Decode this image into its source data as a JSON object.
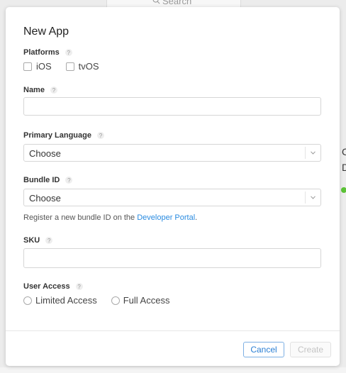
{
  "background": {
    "search_placeholder": "Search",
    "side_text_1": "C",
    "side_text_2": "D"
  },
  "modal": {
    "title": "New App",
    "platforms": {
      "label": "Platforms",
      "options": [
        "iOS",
        "tvOS"
      ]
    },
    "name": {
      "label": "Name",
      "value": ""
    },
    "primary_language": {
      "label": "Primary Language",
      "selected": "Choose"
    },
    "bundle_id": {
      "label": "Bundle ID",
      "selected": "Choose",
      "hint_prefix": "Register a new bundle ID on the ",
      "hint_link": "Developer Portal",
      "hint_suffix": "."
    },
    "sku": {
      "label": "SKU",
      "value": ""
    },
    "user_access": {
      "label": "User Access",
      "options": [
        "Limited Access",
        "Full Access"
      ]
    },
    "help_glyph": "?",
    "buttons": {
      "cancel": "Cancel",
      "create": "Create"
    }
  },
  "colors": {
    "link": "#2a8be0",
    "primary_button": "#2a7fd4",
    "status_dot": "#5bc236"
  }
}
